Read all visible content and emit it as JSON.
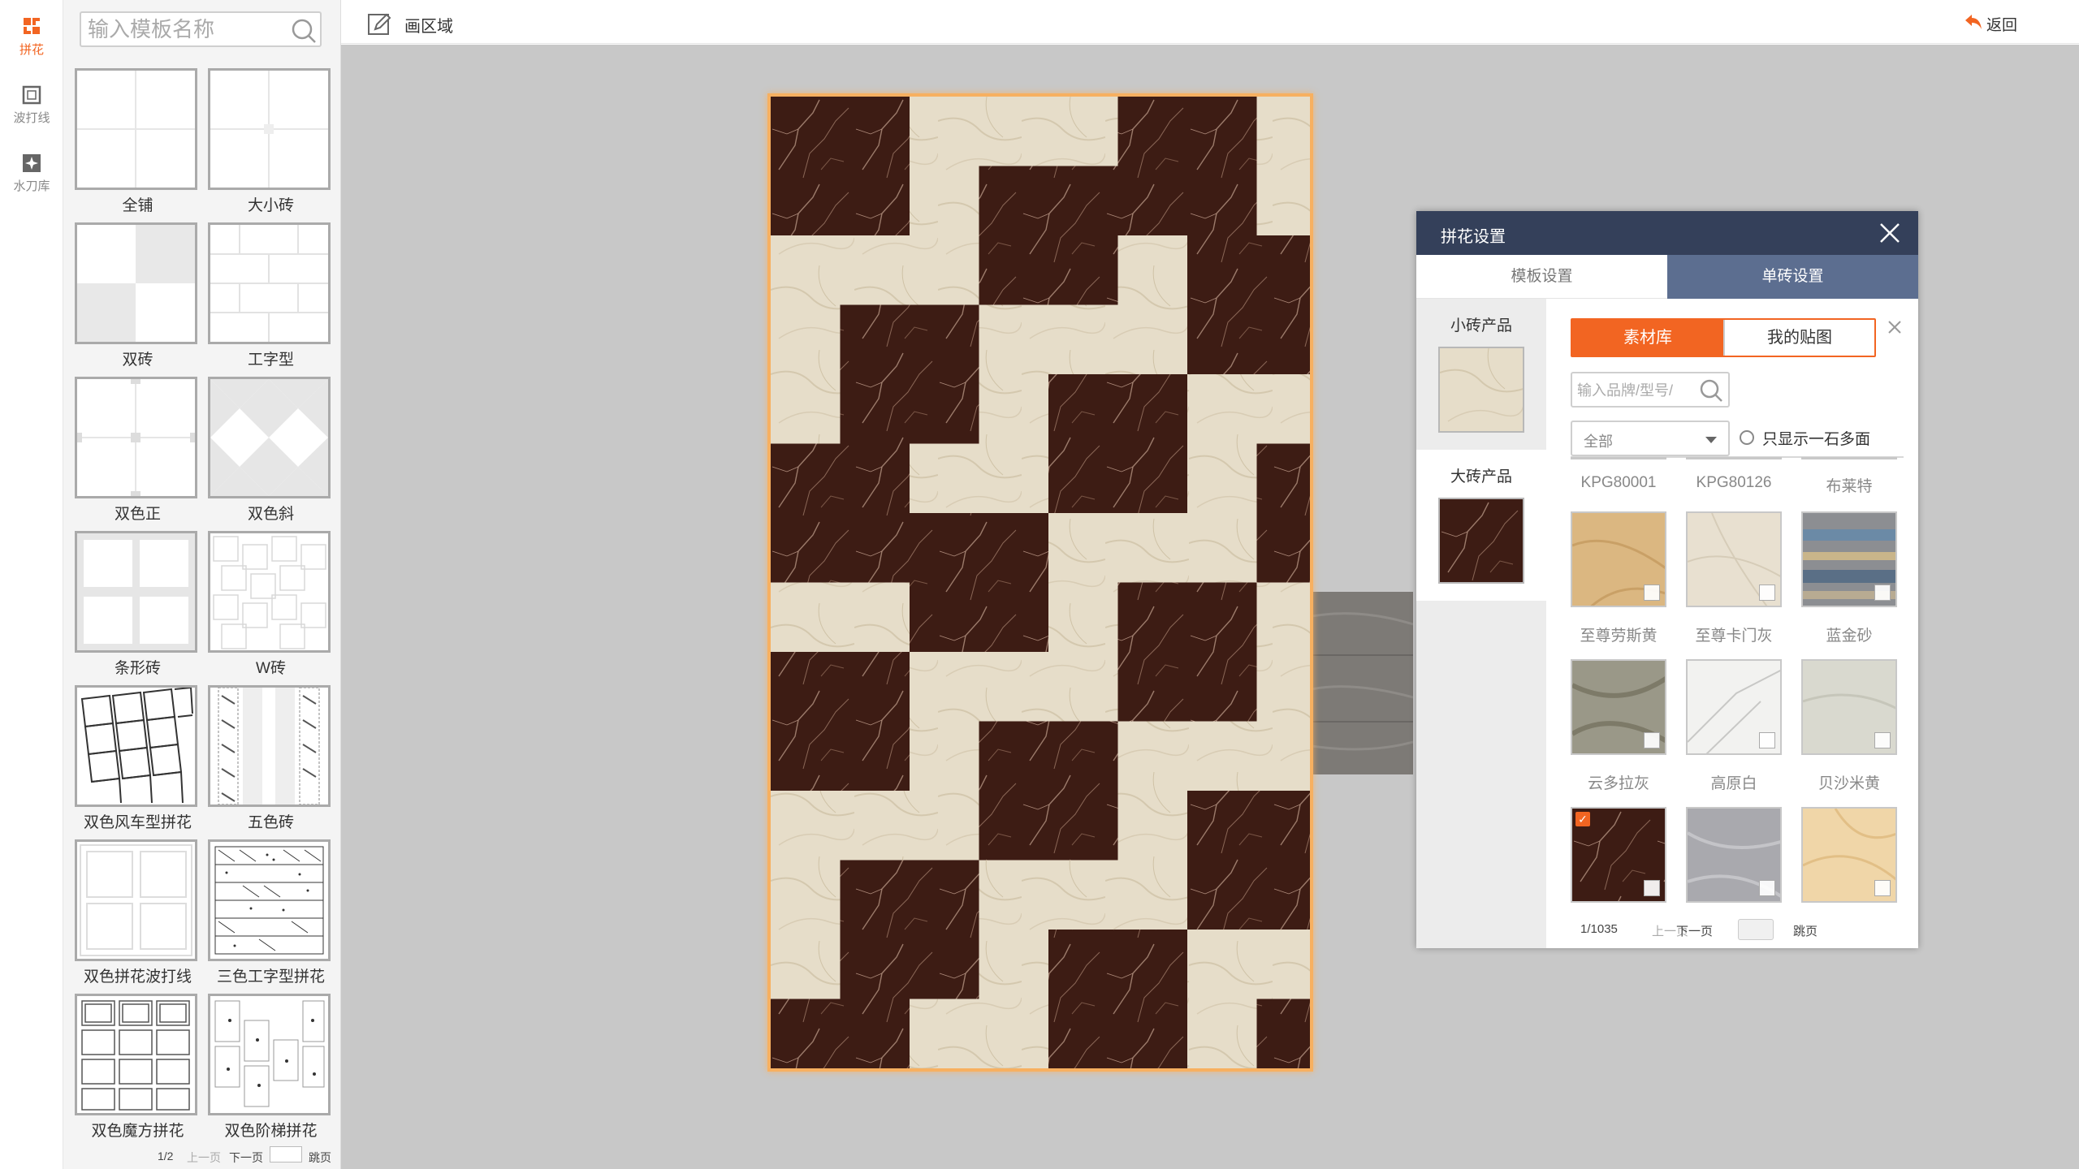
{
  "sidebar": {
    "items": [
      {
        "label": "拼花",
        "icon": "parquet-icon",
        "active": true
      },
      {
        "label": "波打线",
        "icon": "border-line-icon",
        "active": false
      },
      {
        "label": "水刀库",
        "icon": "waterjet-icon",
        "active": false
      }
    ]
  },
  "template_panel": {
    "search_placeholder": "输入模板名称",
    "templates": [
      {
        "label": "全铺"
      },
      {
        "label": "大小砖"
      },
      {
        "label": "双砖"
      },
      {
        "label": "工字型"
      },
      {
        "label": "双色正"
      },
      {
        "label": "双色斜"
      },
      {
        "label": "条形砖"
      },
      {
        "label": "W砖"
      },
      {
        "label": "双色风车型拼花"
      },
      {
        "label": "五色砖"
      },
      {
        "label": "双色拼花波打线"
      },
      {
        "label": "三色工字型拼花"
      },
      {
        "label": "双色魔方拼花"
      },
      {
        "label": "双色阶梯拼花"
      }
    ],
    "pager": {
      "page": "1/2",
      "prev": "上一页",
      "next": "下一页",
      "jump": "跳页"
    }
  },
  "topbar": {
    "draw_area_label": "画区域",
    "back_label": "返回"
  },
  "dialog": {
    "title": "拼花设置",
    "tabs": {
      "template": "模板设置",
      "single": "单砖设置"
    },
    "small_product_label": "小砖产品",
    "large_product_label": "大砖产品",
    "library_tabs": {
      "material": "素材库",
      "mine": "我的贴图"
    },
    "search_placeholder": "输入品牌/型号/",
    "category_selected": "全部",
    "one_stone_label": "只显示一石多面",
    "top_names": [
      "KPG80001",
      "KPG80126",
      "布莱特"
    ],
    "materials": [
      {
        "name": "至尊劳斯黄"
      },
      {
        "name": "至尊卡门灰"
      },
      {
        "name": "蓝金砂"
      },
      {
        "name": "云多拉灰"
      },
      {
        "name": "高原白"
      },
      {
        "name": "贝沙米黄"
      },
      {
        "name": "",
        "selected": true
      },
      {
        "name": ""
      },
      {
        "name": ""
      }
    ],
    "pager": {
      "page": "1/1035",
      "prev": "上一页",
      "next": "下一页",
      "jump": "跳页"
    }
  },
  "colors": {
    "accent": "#f26522",
    "dialog_header": "#34405a",
    "active_tab": "#5c6e90",
    "canvas_bg": "#c8c8c8"
  }
}
